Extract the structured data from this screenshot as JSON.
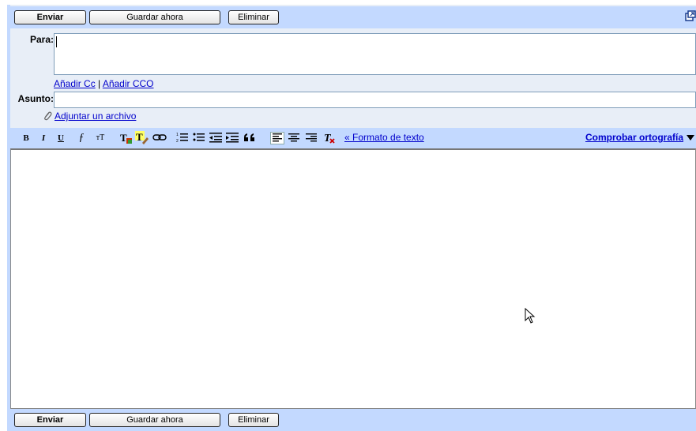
{
  "toolbar_top": {
    "send": "Enviar",
    "save": "Guardar ahora",
    "delete": "Eliminar"
  },
  "toolbar_bottom": {
    "send": "Enviar",
    "save": "Guardar ahora",
    "delete": "Eliminar"
  },
  "to": {
    "label": "Para:",
    "value": ""
  },
  "cc": {
    "add_cc": "Añadir Cc",
    "separator": "|",
    "add_bcc": "Añadir CCO"
  },
  "subject": {
    "label": "Asunto:",
    "value": ""
  },
  "attach": {
    "label": "Adjuntar un archivo"
  },
  "format_bar": {
    "bold": "B",
    "italic": "I",
    "underline": "U",
    "font": "ƒ",
    "size": "тT",
    "plain_text_link": "« Formato de texto",
    "spellcheck": "Comprobar ortografía"
  },
  "colors": {
    "bar": "#c3d9ff",
    "panel": "#e8eef7",
    "link": "#0000cc"
  }
}
